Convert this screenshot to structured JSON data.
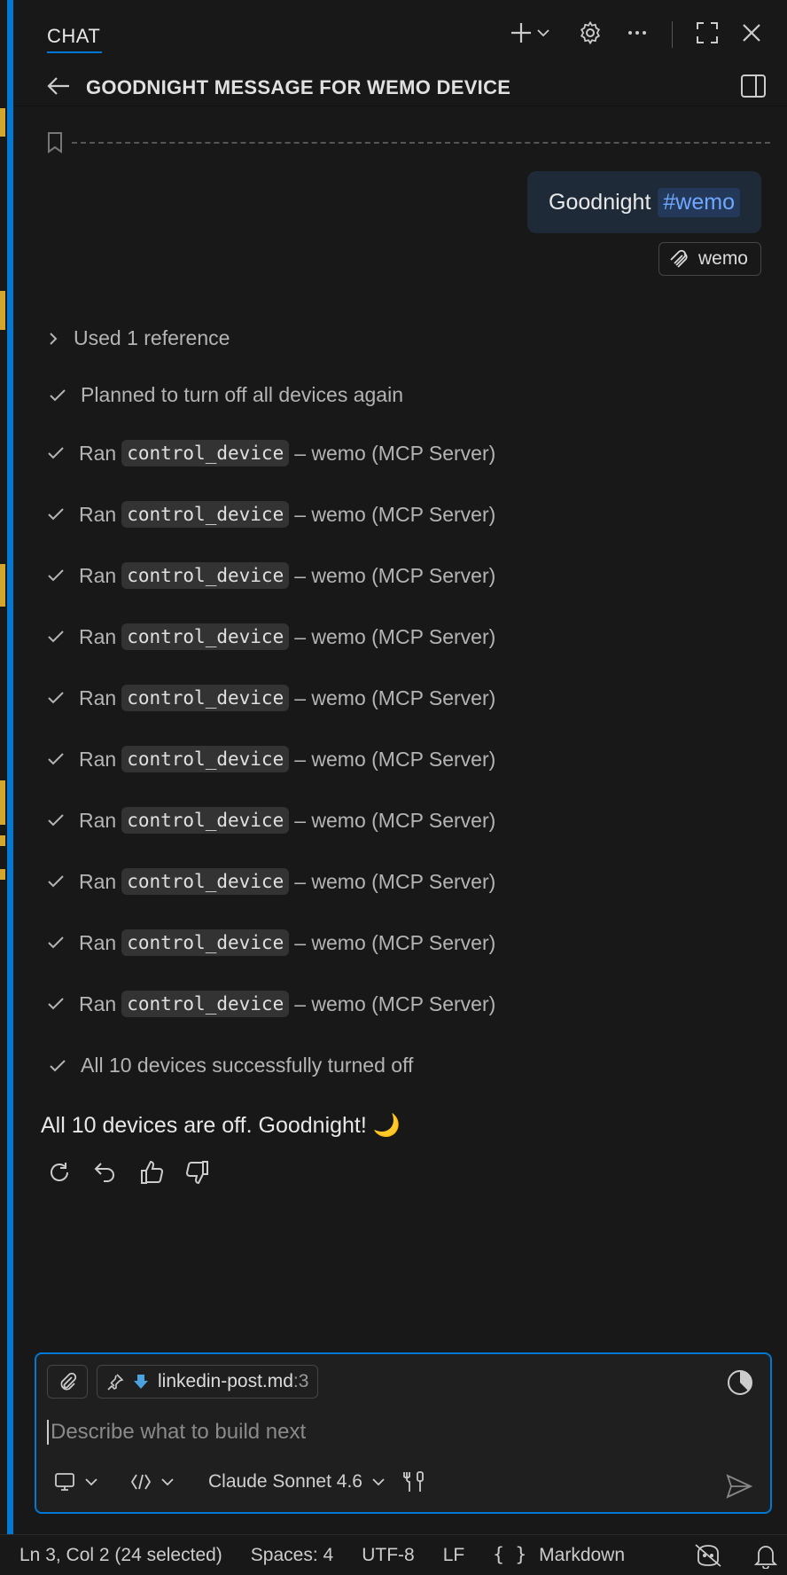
{
  "header": {
    "title": "CHAT"
  },
  "subheader": {
    "title": "GOODNIGHT MESSAGE FOR WEMO DEVICE"
  },
  "user_message": {
    "text": "Goodnight",
    "tag": "#wemo",
    "context_chip": "wemo"
  },
  "references": {
    "label": "Used 1 reference"
  },
  "steps": [
    {
      "type": "plain",
      "text": "Planned to turn off all devices again"
    },
    {
      "type": "tool",
      "prefix": "Ran",
      "tool": "control_device",
      "suffix": "– wemo (MCP Server)"
    },
    {
      "type": "tool",
      "prefix": "Ran",
      "tool": "control_device",
      "suffix": "– wemo (MCP Server)"
    },
    {
      "type": "tool",
      "prefix": "Ran",
      "tool": "control_device",
      "suffix": "– wemo (MCP Server)"
    },
    {
      "type": "tool",
      "prefix": "Ran",
      "tool": "control_device",
      "suffix": "– wemo (MCP Server)"
    },
    {
      "type": "tool",
      "prefix": "Ran",
      "tool": "control_device",
      "suffix": "– wemo (MCP Server)"
    },
    {
      "type": "tool",
      "prefix": "Ran",
      "tool": "control_device",
      "suffix": "– wemo (MCP Server)"
    },
    {
      "type": "tool",
      "prefix": "Ran",
      "tool": "control_device",
      "suffix": "– wemo (MCP Server)"
    },
    {
      "type": "tool",
      "prefix": "Ran",
      "tool": "control_device",
      "suffix": "– wemo (MCP Server)"
    },
    {
      "type": "tool",
      "prefix": "Ran",
      "tool": "control_device",
      "suffix": "– wemo (MCP Server)"
    },
    {
      "type": "tool",
      "prefix": "Ran",
      "tool": "control_device",
      "suffix": "– wemo (MCP Server)"
    },
    {
      "type": "plain",
      "text": "All 10 devices successfully turned off"
    }
  ],
  "response": {
    "text": "All 10 devices are off. Goodnight! 🌙"
  },
  "input": {
    "file_name": "linkedin-post.md",
    "file_line": ":3",
    "placeholder": "Describe what to build next",
    "model": "Claude Sonnet 4.6"
  },
  "status_bar": {
    "position": "Ln 3, Col 2 (24 selected)",
    "spaces": "Spaces: 4",
    "encoding": "UTF-8",
    "eol": "LF",
    "language": "Markdown"
  },
  "colors": {
    "accent": "#0078d4",
    "background": "#181818",
    "tag": "#6ea8ff"
  }
}
